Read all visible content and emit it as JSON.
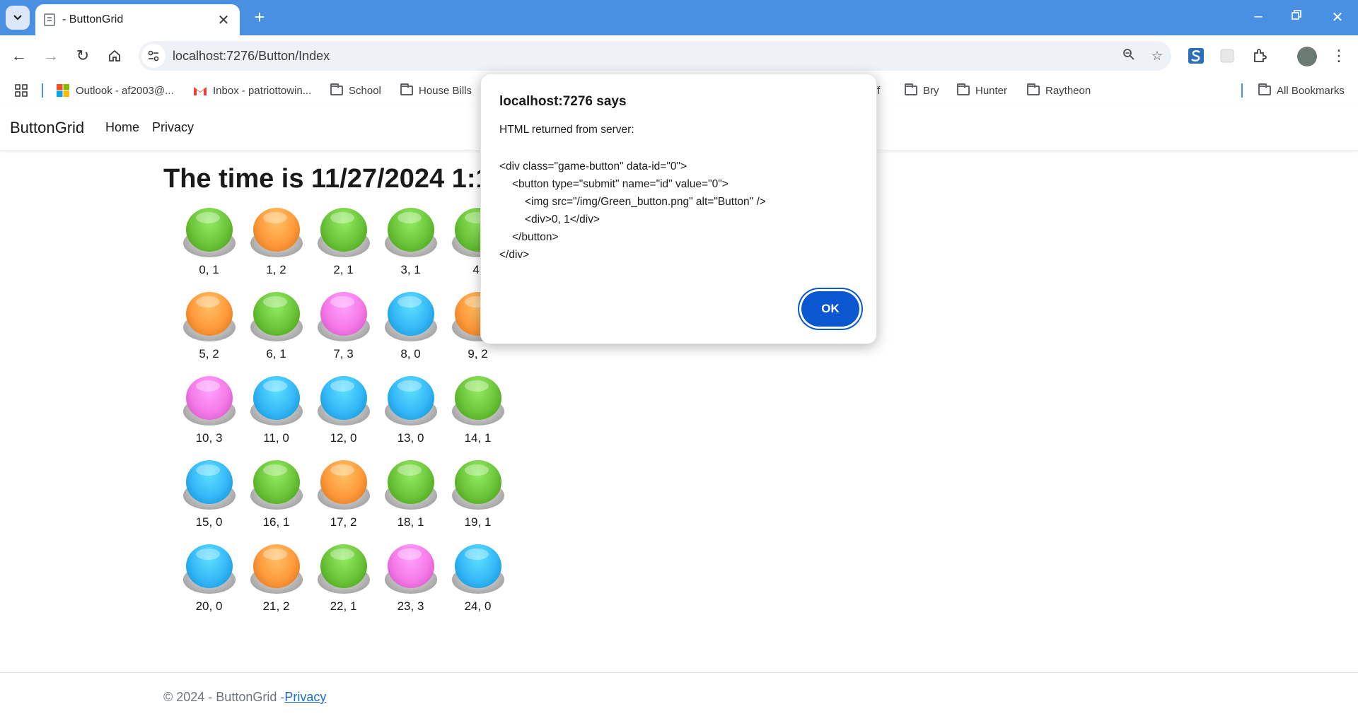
{
  "browser": {
    "tab_title": "- ButtonGrid",
    "new_tab_symbol": "+",
    "url": "localhost:7276/Button/Index"
  },
  "bookmarks": [
    {
      "label": "Outlook - af2003@...",
      "icon": "microsoft-logo-icon"
    },
    {
      "label": "Inbox - patriottowin...",
      "icon": "gmail-icon"
    },
    {
      "label": "School",
      "icon": "folder-icon"
    },
    {
      "label": "House Bills",
      "icon": "folder-icon"
    },
    {
      "label": "uff",
      "icon": "folder-icon"
    },
    {
      "label": "Bry",
      "icon": "folder-icon"
    },
    {
      "label": "Hunter",
      "icon": "folder-icon"
    },
    {
      "label": "Raytheon",
      "icon": "folder-icon"
    },
    {
      "label": "All Bookmarks",
      "icon": "folder-icon"
    }
  ],
  "page": {
    "brand": "ButtonGrid",
    "nav_home": "Home",
    "nav_privacy": "Privacy",
    "heading": "The time is 11/27/2024 1:11:1",
    "footer_text": "© 2024 - ButtonGrid -",
    "footer_link": "Privacy"
  },
  "colors": {
    "green": "#6cc43a",
    "orange": "#ff9a3c",
    "pink": "#f57ae8",
    "blue": "#35b8f7",
    "browser_accent": "#4a90e2",
    "ok_button": "#0b57d0"
  },
  "grid": [
    {
      "label": "0, 1",
      "color": "green"
    },
    {
      "label": "1, 2",
      "color": "orange"
    },
    {
      "label": "2, 1",
      "color": "green"
    },
    {
      "label": "3, 1",
      "color": "green"
    },
    {
      "label": "4,",
      "color": "green"
    },
    {
      "label": "5, 2",
      "color": "orange"
    },
    {
      "label": "6, 1",
      "color": "green"
    },
    {
      "label": "7, 3",
      "color": "pink"
    },
    {
      "label": "8, 0",
      "color": "blue"
    },
    {
      "label": "9, 2",
      "color": "orange"
    },
    {
      "label": "10, 3",
      "color": "pink"
    },
    {
      "label": "11, 0",
      "color": "blue"
    },
    {
      "label": "12, 0",
      "color": "blue"
    },
    {
      "label": "13, 0",
      "color": "blue"
    },
    {
      "label": "14, 1",
      "color": "green"
    },
    {
      "label": "15, 0",
      "color": "blue"
    },
    {
      "label": "16, 1",
      "color": "green"
    },
    {
      "label": "17, 2",
      "color": "orange"
    },
    {
      "label": "18, 1",
      "color": "green"
    },
    {
      "label": "19, 1",
      "color": "green"
    },
    {
      "label": "20, 0",
      "color": "blue"
    },
    {
      "label": "21, 2",
      "color": "orange"
    },
    {
      "label": "22, 1",
      "color": "green"
    },
    {
      "label": "23, 3",
      "color": "pink"
    },
    {
      "label": "24, 0",
      "color": "blue"
    }
  ],
  "dialog": {
    "title": "localhost:7276 says",
    "message": "HTML returned from server:",
    "lines": [
      "<div class=\"game-button\" data-id=\"0\">",
      "<button type=\"submit\" name=\"id\" value=\"0\">",
      "<img src=\"/img/Green_button.png\" alt=\"Button\" />",
      "<div>0, 1</div>",
      "</button>",
      "</div>"
    ],
    "ok_label": "OK"
  }
}
